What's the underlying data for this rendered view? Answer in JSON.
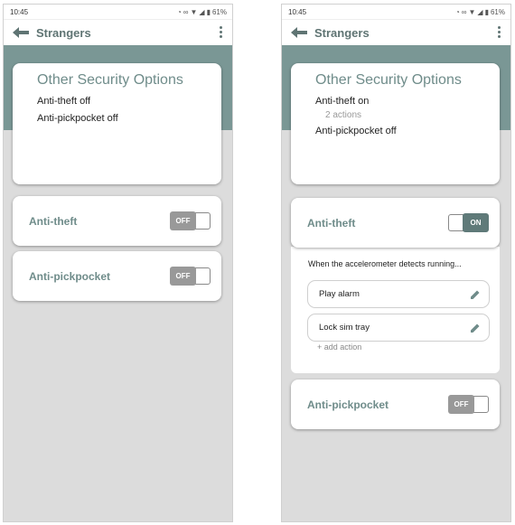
{
  "status_bar": {
    "time": "10:45",
    "battery": "61%"
  },
  "app_bar": {
    "title": "Strangers"
  },
  "left_screen": {
    "summary": {
      "title": "Other Security Options",
      "anti_theft_status": "Anti-theft off",
      "anti_pickpocket_status": "Anti-pickpocket off"
    },
    "anti_theft": {
      "label": "Anti-theft",
      "toggle": "OFF"
    },
    "anti_pickpocket": {
      "label": "Anti-pickpocket",
      "toggle": "OFF"
    }
  },
  "right_screen": {
    "summary": {
      "title": "Other Security Options",
      "anti_theft_status": "Anti-theft on",
      "anti_theft_actions": "2 actions",
      "anti_pickpocket_status": "Anti-pickpocket off"
    },
    "anti_theft": {
      "label": "Anti-theft",
      "toggle": "ON"
    },
    "trigger": "When the accelerometer detects running...",
    "actions": [
      "Play alarm",
      "Lock sim tray"
    ],
    "add_action": "+ add action",
    "anti_pickpocket": {
      "label": "Anti-pickpocket",
      "toggle": "OFF"
    }
  },
  "colors": {
    "accent": "#6f8c8a",
    "band": "#7a9795",
    "toggle_on": "#5f7a79",
    "toggle_off": "#999999"
  },
  "icons": [
    "back-arrow",
    "more-vert",
    "edit-pencil"
  ]
}
